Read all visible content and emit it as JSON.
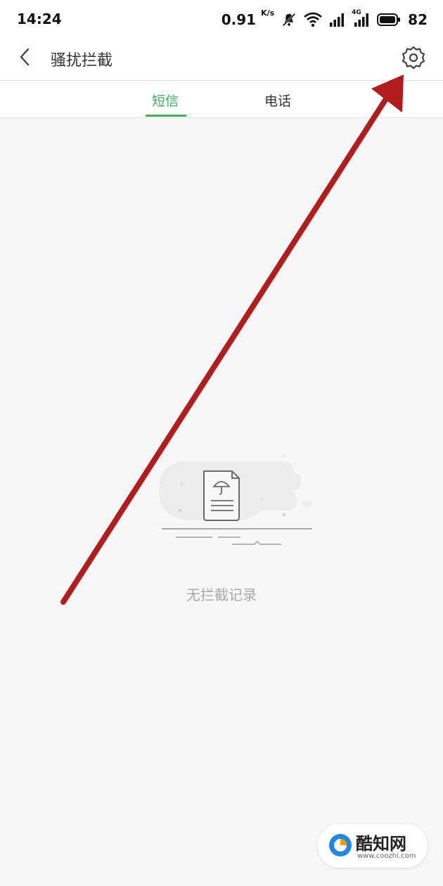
{
  "status_bar": {
    "time": "14:24",
    "speed": "0.91",
    "speed_unit": "K/s",
    "network": "4G",
    "battery": "82",
    "icons": [
      "mute-bell-icon",
      "wifi-icon",
      "signal-icon",
      "signal-4g-icon",
      "battery-icon"
    ]
  },
  "header": {
    "title": "骚扰拦截",
    "back_icon": "back-arrow-icon",
    "settings_icon": "gear-icon"
  },
  "tabs": [
    {
      "label": "短信",
      "active": true
    },
    {
      "label": "电话",
      "active": false
    }
  ],
  "empty_state": {
    "message": "无拦截记录",
    "icon": "document-umbrella-icon"
  },
  "annotation": {
    "arrow_color": "#b31c1c"
  },
  "watermark": {
    "name": "酷知网",
    "url": "www.coozhi.com"
  },
  "colors": {
    "accent": "#3db05b",
    "background": "#f7f7f7"
  }
}
